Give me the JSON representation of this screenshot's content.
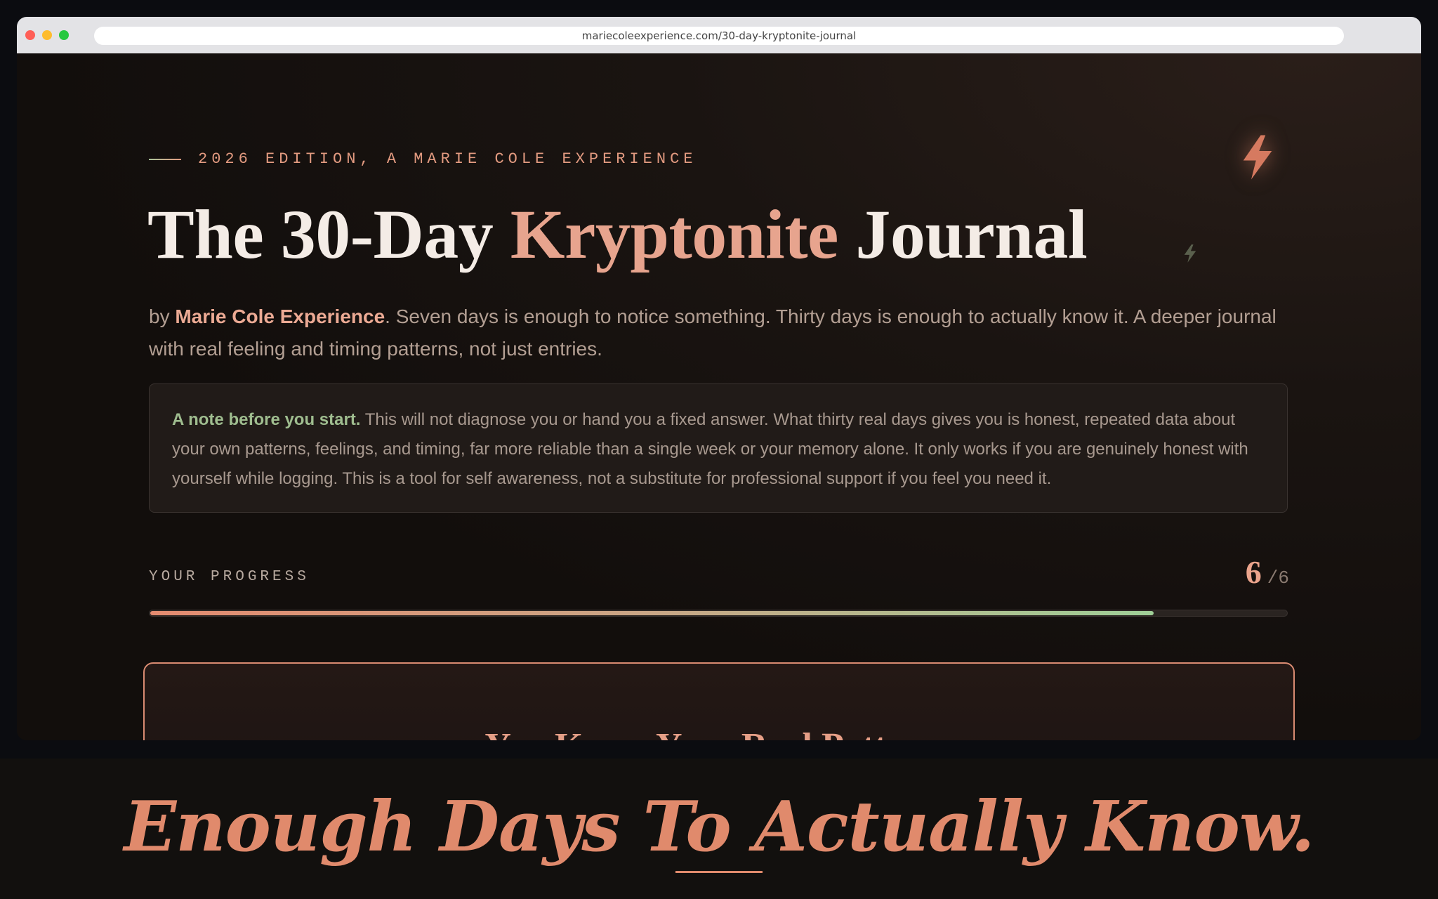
{
  "browser": {
    "url": "mariecoleexperience.com/30-day-kryptonite-journal"
  },
  "hero": {
    "eyebrow": "2026 EDITION, A MARIE COLE EXPERIENCE",
    "title_part1": "The 30-Day ",
    "title_accent": "Kryptonite",
    "title_part2": " Journal",
    "byline_prefix": "by ",
    "byline_author": "Marie Cole Experience",
    "byline_text": ". Seven days is enough to notice something. Thirty days is enough to actually know it. A deeper journal with real feeling and timing patterns, not just entries."
  },
  "note": {
    "lead": "A note before you start.",
    "text": " This will not diagnose you or hand you a fixed answer. What thirty real days gives you is honest, repeated data about your own patterns, feelings, and timing, far more reliable than a single week or your memory alone. It only works if you are genuinely honest with yourself while logging. This is a tool for self awareness, not a substitute for professional support if you feel you need it."
  },
  "progress": {
    "label": "YOUR PROGRESS",
    "current": "6",
    "total": "/6",
    "fill_fraction": 0.883
  },
  "card": {
    "title": "You Know Your Real Patterns"
  },
  "banner": {
    "text": "Enough Days To Actually Know."
  },
  "icons": {
    "decor_large": "lightning-bolt-icon",
    "decor_small": "lightning-bolt-icon"
  },
  "colors": {
    "accent": "#e7a48e",
    "green": "#9fbd8f",
    "background": "#140f0d"
  }
}
